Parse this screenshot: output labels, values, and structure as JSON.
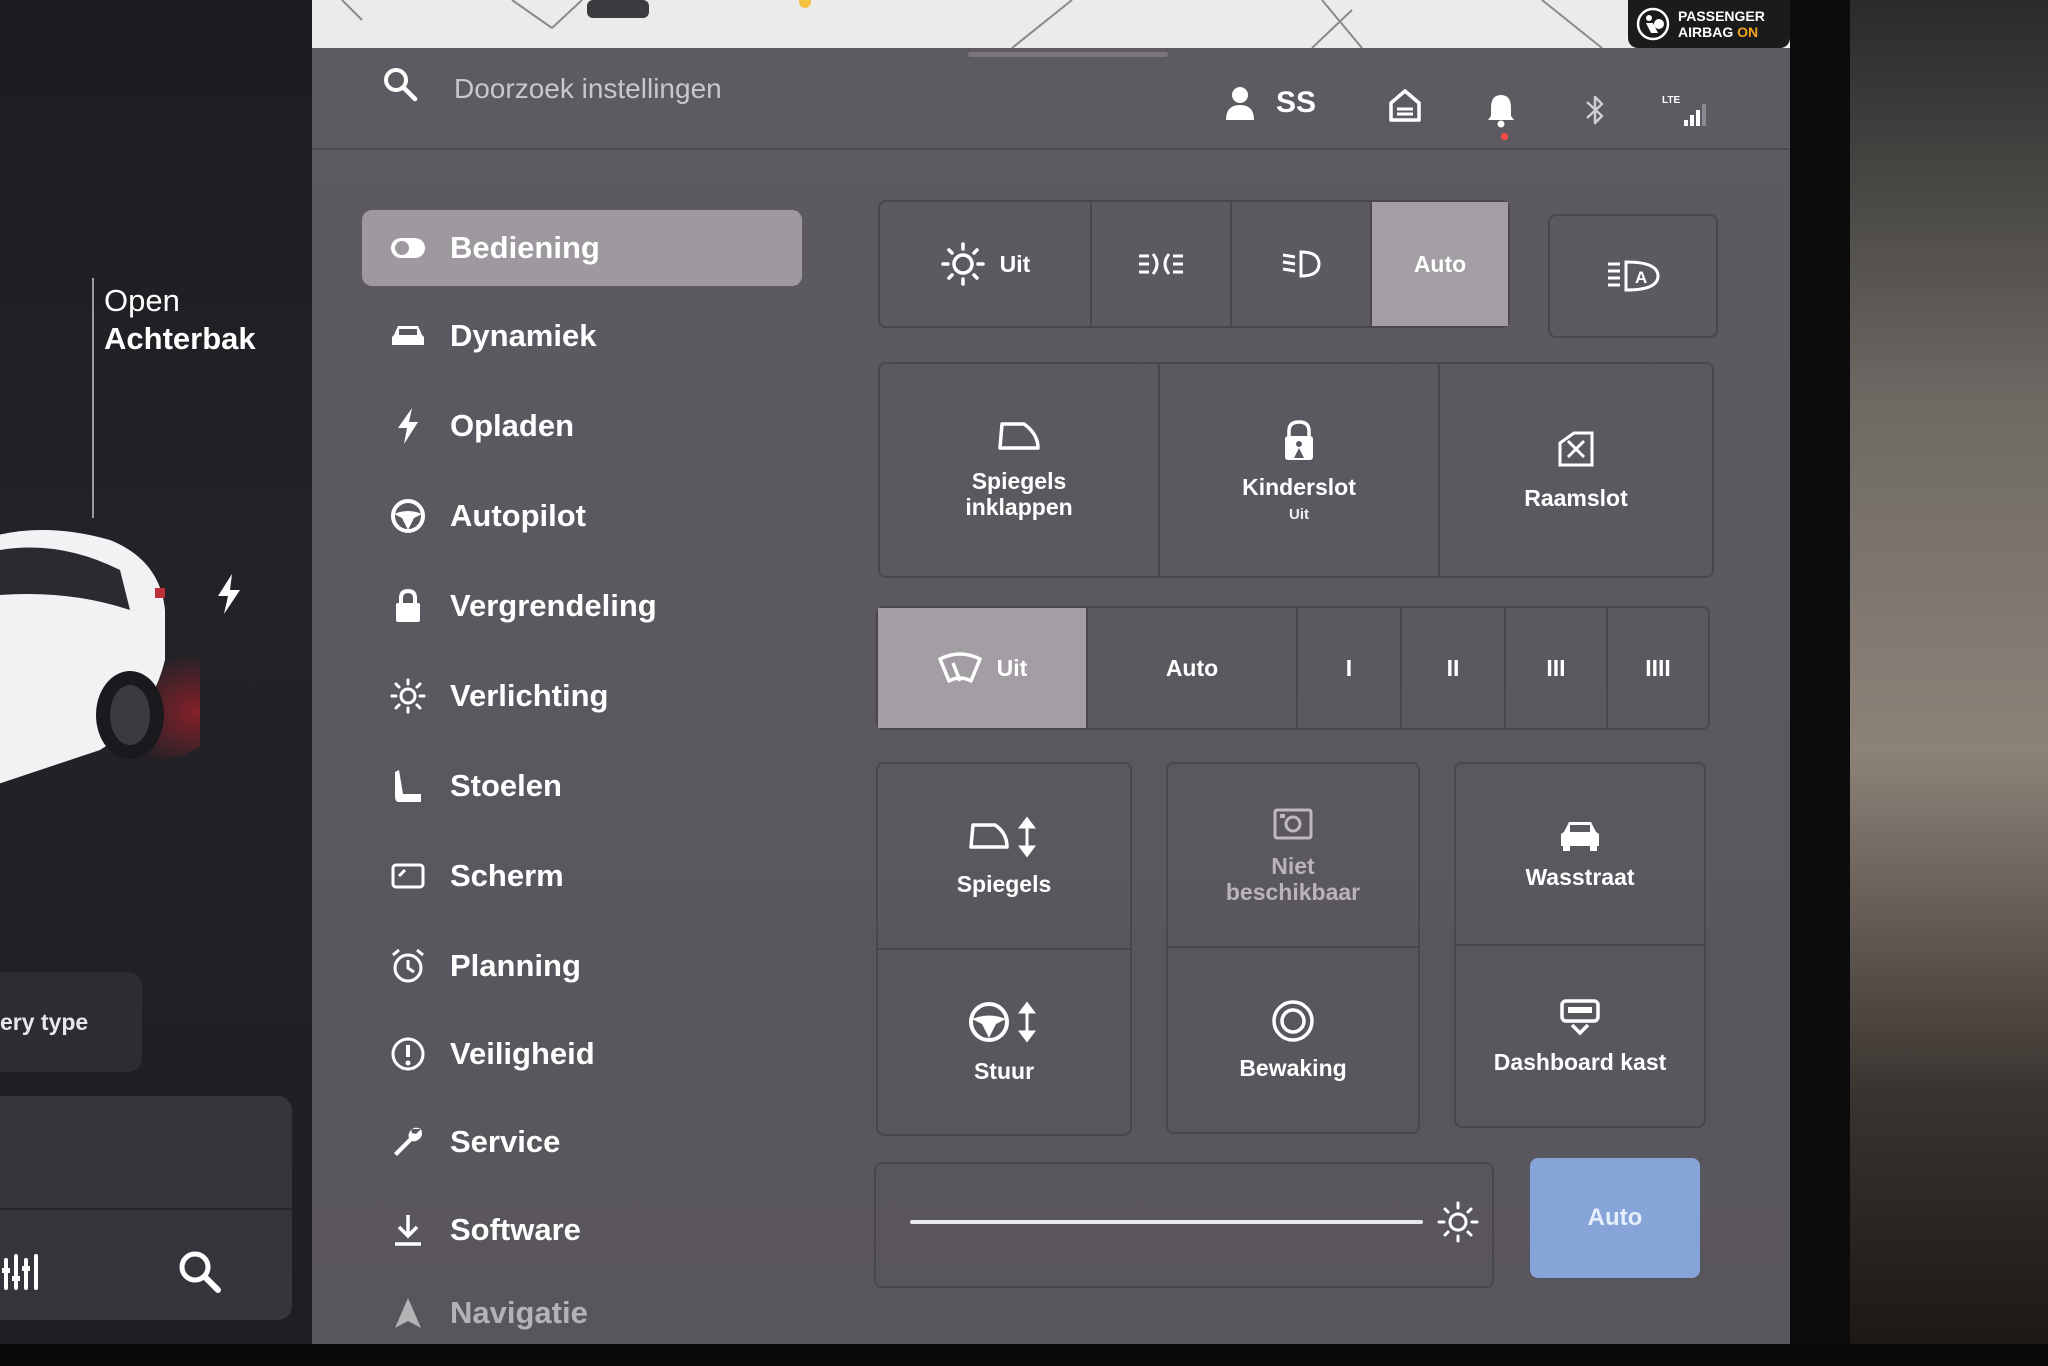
{
  "airbag": {
    "line1": "PASSENGER",
    "line2a": "AIRBAG ",
    "line2b": "ON"
  },
  "search": {
    "placeholder": "Doorzoek instellingen"
  },
  "header": {
    "user_initials": "SS"
  },
  "car_panel": {
    "trunk_label_line1": "Open",
    "trunk_label_line2": "Achterbak",
    "card_text": "ery type"
  },
  "sidebar": {
    "items": [
      {
        "label": "Bediening",
        "icon": "toggle-icon",
        "active": true
      },
      {
        "label": "Dynamiek",
        "icon": "car-icon"
      },
      {
        "label": "Opladen",
        "icon": "bolt-icon"
      },
      {
        "label": "Autopilot",
        "icon": "steering-wheel-icon"
      },
      {
        "label": "Vergrendeling",
        "icon": "lock-icon"
      },
      {
        "label": "Verlichting",
        "icon": "light-icon"
      },
      {
        "label": "Stoelen",
        "icon": "seat-icon"
      },
      {
        "label": "Scherm",
        "icon": "display-icon"
      },
      {
        "label": "Planning",
        "icon": "alarm-clock-icon"
      },
      {
        "label": "Veiligheid",
        "icon": "alert-icon"
      },
      {
        "label": "Service",
        "icon": "wrench-icon"
      },
      {
        "label": "Software",
        "icon": "download-icon"
      },
      {
        "label": "Navigatie",
        "icon": "navigation-icon"
      }
    ]
  },
  "lights": {
    "off_label": "Uit",
    "auto_label": "Auto",
    "selected": "Auto"
  },
  "controls_row": {
    "mirrors_fold": "Spiegels\ninklappen",
    "child_lock": "Kinderslot",
    "child_lock_status": "Uit",
    "window_lock": "Raamslot"
  },
  "wipers": {
    "off_label": "Uit",
    "auto_label": "Auto",
    "speeds": [
      "I",
      "II",
      "III",
      "IIII"
    ],
    "selected": "Uit"
  },
  "grid": {
    "mirrors": "Spiegels",
    "unavailable": "Niet\nbeschikbaar",
    "car_wash": "Wasstraat",
    "steering": "Stuur",
    "sentry": "Bewaking",
    "glovebox": "Dashboard kast"
  },
  "brightness": {
    "auto_label": "Auto",
    "level": 0.95
  }
}
